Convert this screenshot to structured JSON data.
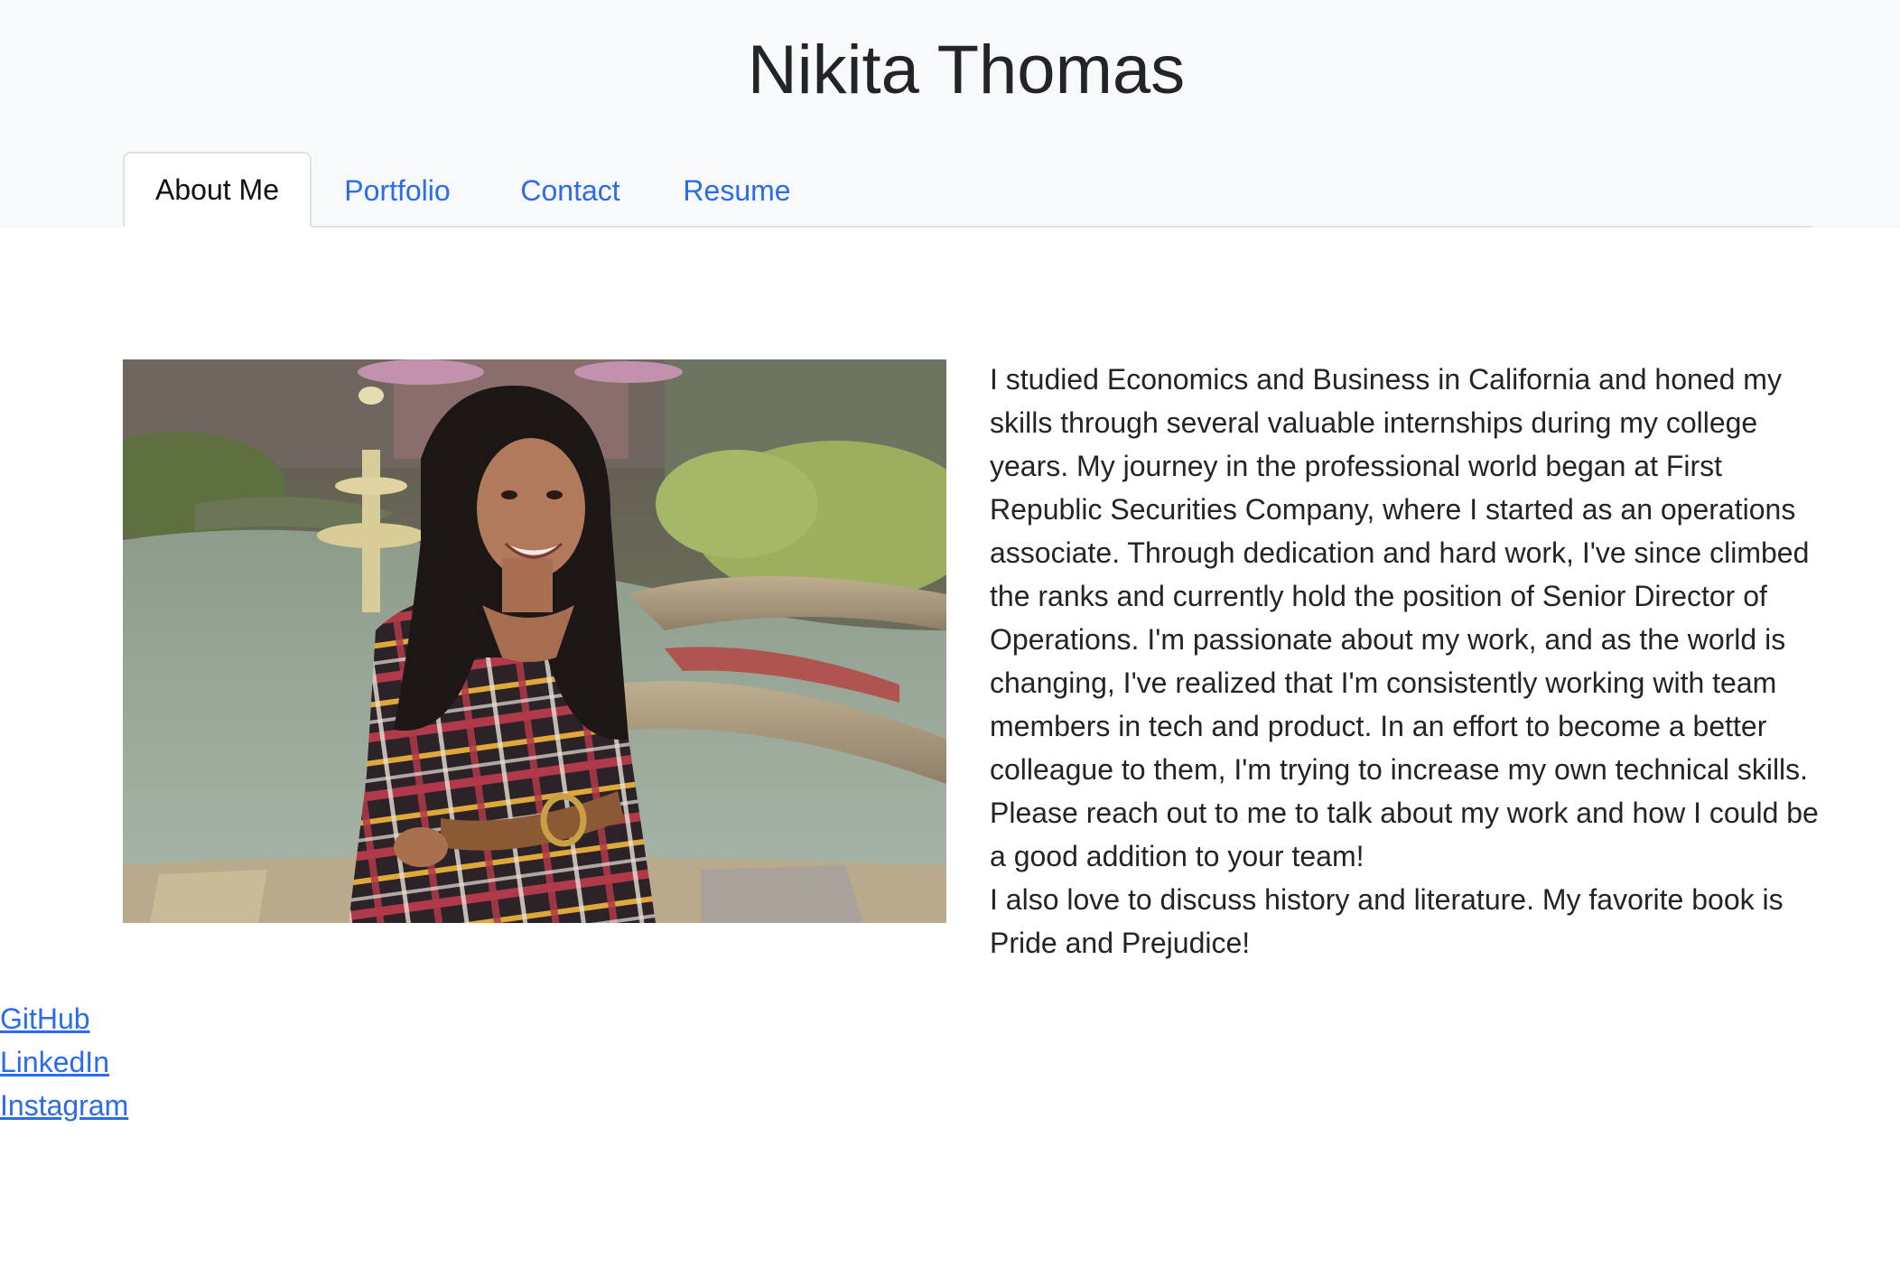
{
  "header": {
    "title": "Nikita Thomas"
  },
  "tabs": [
    {
      "label": "About Me",
      "active": true
    },
    {
      "label": "Portfolio",
      "active": false
    },
    {
      "label": "Contact",
      "active": false
    },
    {
      "label": "Resume",
      "active": false
    }
  ],
  "about": {
    "paragraph_1": "I studied Economics and Business in California and honed my skills through several valuable internships during my college years. My journey in the professional world began at First Republic Securities Company, where I started as an operations associate. Through dedication and hard work, I've since climbed the ranks and currently hold the position of Senior Director of Operations. I'm passionate about my work, and as the world is changing, I've realized that I'm consistently working with team members in tech and product. In an effort to become a better colleague to them, I'm trying to increase my own technical skills. Please reach out to me to talk about my work and how I could be a good addition to your team!",
    "paragraph_2": "I also love to discuss history and literature. My favorite book is Pride and Prejudice!"
  },
  "social_links": [
    {
      "label": "GitHub"
    },
    {
      "label": "LinkedIn"
    },
    {
      "label": "Instagram"
    }
  ],
  "colors": {
    "header_bg": "#f8f9fa",
    "link": "#2b6bec",
    "text": "#212529"
  }
}
